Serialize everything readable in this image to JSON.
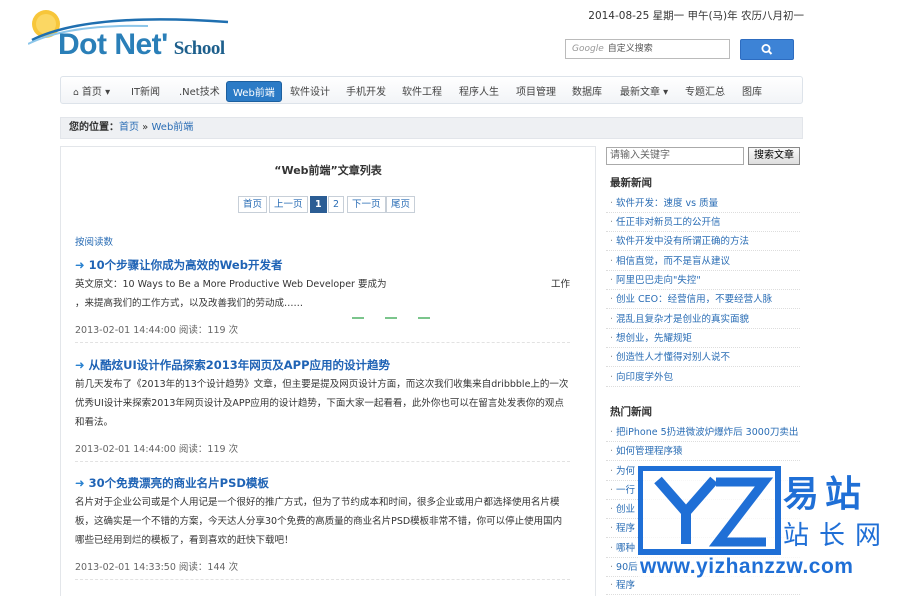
{
  "header": {
    "logo_main": "Dot Net'",
    "logo_sub": "School",
    "date": "2014-08-25 星期一 甲午(马)年 农历八月初一",
    "search": {
      "brand": "Google",
      "placeholder": "自定义搜索"
    }
  },
  "nav": [
    {
      "label": "首页 ▾"
    },
    {
      "label": "IT新闻"
    },
    {
      "label": ".Net技术"
    },
    {
      "label": "Web前端"
    },
    {
      "label": "软件设计"
    },
    {
      "label": "手机开发"
    },
    {
      "label": "软件工程"
    },
    {
      "label": "程序人生"
    },
    {
      "label": "项目管理"
    },
    {
      "label": "数据库"
    },
    {
      "label": "最新文章 ▾"
    },
    {
      "label": "专题汇总"
    },
    {
      "label": "图库"
    }
  ],
  "breadcrumb": {
    "prefix": "您的位置：",
    "home": "首页",
    "sep": " » ",
    "current": "Web前端"
  },
  "list": {
    "title": "“Web前端”文章列表",
    "sort_label": "按阅读数",
    "pager": [
      {
        "label": "首页"
      },
      {
        "label": "上一页"
      },
      {
        "label": "1",
        "current": true
      },
      {
        "label": "2"
      },
      {
        "label": "下一页"
      },
      {
        "label": "尾页"
      }
    ]
  },
  "articles": [
    {
      "title": "10个步骤让你成为高效的Web开发者",
      "body_line1": "英文原文：10 Ways to Be a More Productive Web Developer 要成为",
      "body_line1_tail": "工作",
      "body_line2": "，来提高我们的工作方式，以及改善我们的劳动成……",
      "meta": "2013-02-01 14:44:00 阅读：119 次"
    },
    {
      "title": "从酷炫UI设计作品探索2013年网页及APP应用的设计趋势",
      "body": "前几天发布了《2013年的13个设计趋势》文章，但主要是提及网页设计方面，而这次我们收集来自dribbble上的一次优秀UI设计来探索2013年网页设计及APP应用的设计趋势，下面大家一起看看，此外你也可以在留言处发表你的观点和看法。",
      "meta": "2013-02-01 14:44:00 阅读：119 次"
    },
    {
      "title": "30个免费漂亮的商业名片PSD模板",
      "body": "名片对于企业公司或是个人用记是一个很好的推广方式，但为了节约成本和时间，很多企业或用户都选择使用名片模板，这确实是一个不错的方案，今天达人分享30个免费的高质量的商业名片PSD模板非常不错，你可以停止使用国内哪些已经用到烂的模板了，看到喜欢的赶快下载吧！",
      "meta": "2013-02-01 14:33:50 阅读：144 次"
    }
  ],
  "sidebar": {
    "keyword_placeholder": "请输入关键字",
    "search_button": "搜索文章",
    "latest_heading": "最新新闻",
    "latest": [
      "软件开发：速度 vs 质量",
      "任正非对新员工的公开信",
      "软件开发中没有所谓正确的方法",
      "相信直觉，而不是盲从建议",
      "阿里巴巴走向\"失控\"",
      "创业 CEO：经营信用，不要经营人脉",
      "混乱且复杂才是创业的真实面貌",
      "想创业，先耀规矩",
      "创造性人才懂得对别人说不",
      "向印度学外包"
    ],
    "hot_heading": "热门新闻",
    "hot": [
      "把iPhone 5扔进微波炉爆炸后 3000刀卖出",
      "如何管理程序猿",
      "为何",
      "一行",
      "创业",
      "程序",
      "哪种",
      "90后",
      "程序"
    ]
  },
  "watermark": {
    "letters": "YZ",
    "cn_line1": "易站",
    "cn_line2": "站长网",
    "url": "www.yizhanzzw.com"
  }
}
